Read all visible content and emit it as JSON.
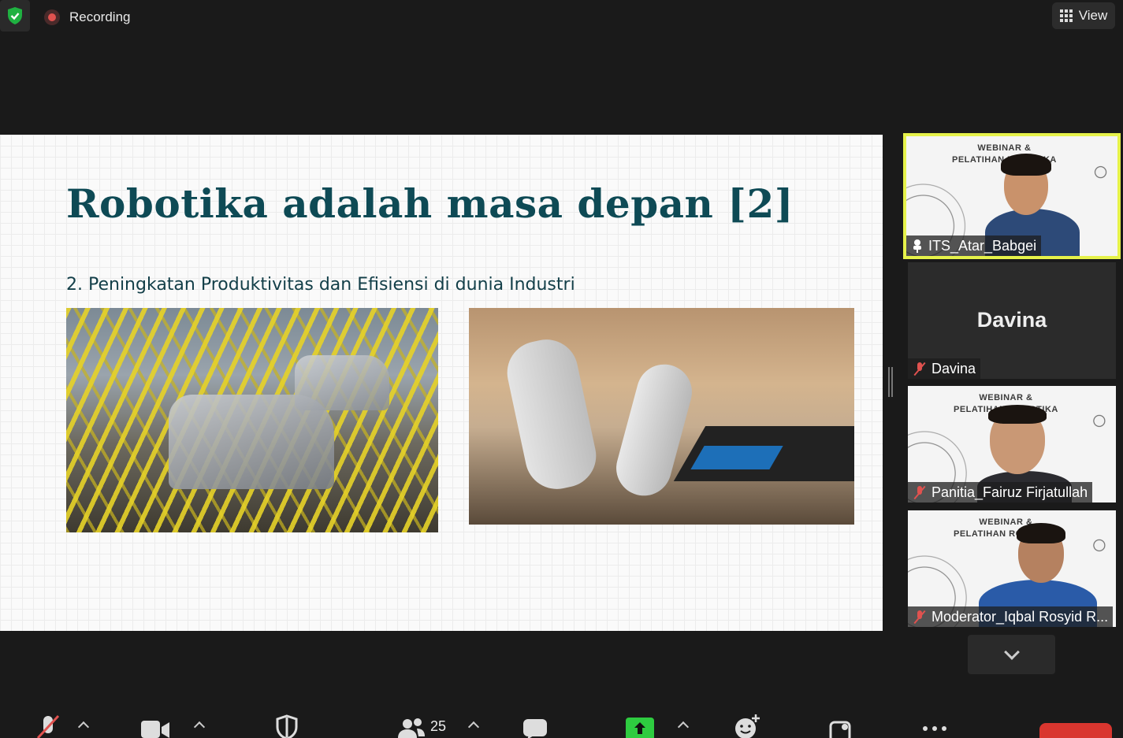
{
  "topbar": {
    "recording_label": "Recording",
    "view_label": "View"
  },
  "slide": {
    "title": "Robotika adalah masa depan [2]",
    "subtitle": "2. Peningkatan Produktivitas dan Efisiensi di dunia Industri"
  },
  "participants": [
    {
      "name": "ITS_Atar_Babgei",
      "speaking": true,
      "banner": "WEBINAR & PELATIHAN ROBOTIKA"
    },
    {
      "name": "Davina",
      "display_name": "Davina",
      "muted": true,
      "video": false
    },
    {
      "name": "Panitia_Fairuz Firjatullah",
      "muted": true,
      "banner": "WEBINAR & PELATIHAN ROBOTIKA"
    },
    {
      "name": "Moderator_Iqbal Rosyid R...",
      "muted": true,
      "banner": "WEBINAR & PELATIHAN ROBOTIKA"
    }
  ],
  "toolbar": {
    "participants_count": "25"
  },
  "colors": {
    "active_speaker_border": "#e6f24a",
    "slide_title": "#0e4a55",
    "muted_red": "#e0524f",
    "share_green": "#2ecc40",
    "end_red": "#d9362f"
  }
}
